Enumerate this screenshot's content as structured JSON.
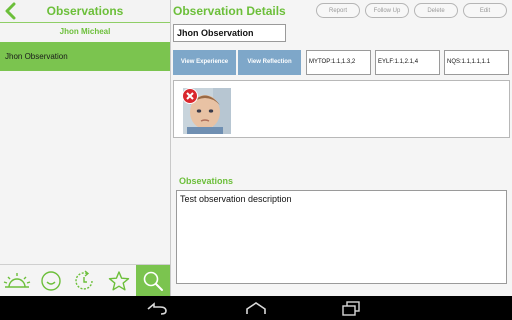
{
  "left_pane": {
    "title": "Observations",
    "child_name": "Jhon  Micheal",
    "items": [
      {
        "label": "Jhon Observation",
        "selected": true
      }
    ],
    "tabs": [
      {
        "icon": "sunrise-icon",
        "active": false
      },
      {
        "icon": "smile-icon",
        "active": false
      },
      {
        "icon": "refresh-clock-icon",
        "active": false
      },
      {
        "icon": "star-icon",
        "active": false
      },
      {
        "icon": "search-icon",
        "active": true
      }
    ]
  },
  "details": {
    "title": "Observation Details",
    "actions": {
      "report": "Report",
      "follow_up": "Follow Up",
      "delete": "Delete",
      "edit": "Edit"
    },
    "observation_title": "Jhon Observation",
    "view_experience": "View Experience",
    "view_reflection": "View Reflection",
    "codes": [
      "MYTOP:1.1,1.3,2",
      "EYLF:1.1,2.1,4",
      "NQS:1.1,1.1,1.1"
    ],
    "observations_label": "Obsevations",
    "observation_text": "Test observation description"
  },
  "colors": {
    "accent_green": "#7bc44f",
    "title_green": "#6cbf3a",
    "button_blue": "#7ea7c9",
    "nav_bar": "#000000"
  },
  "nav_bar": {
    "icons": [
      "back-icon",
      "home-icon",
      "recent-apps-icon"
    ]
  }
}
